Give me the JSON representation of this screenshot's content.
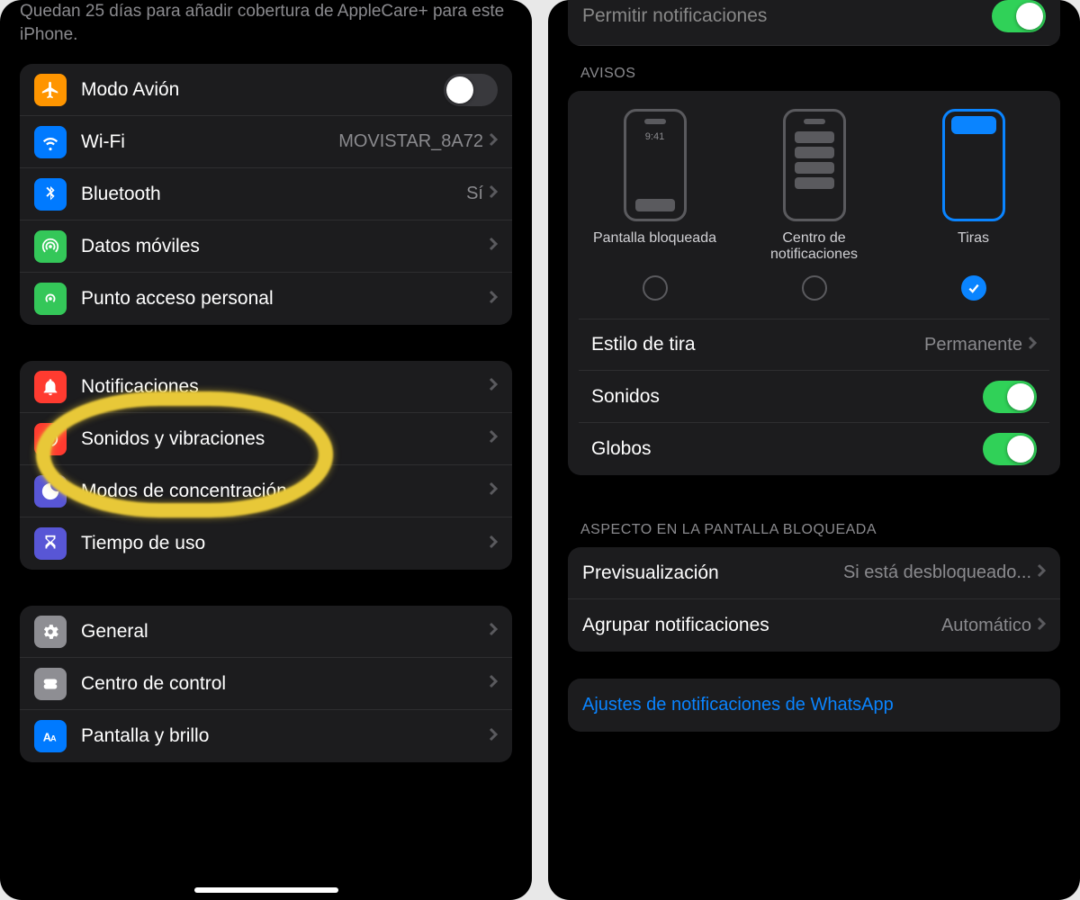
{
  "left": {
    "applecare_note": "Quedan 25 días para añadir cobertura de AppleCare+ para este iPhone.",
    "group1": {
      "airplane": "Modo Avión",
      "wifi": "Wi-Fi",
      "wifi_value": "MOVISTAR_8A72",
      "bluetooth": "Bluetooth",
      "bluetooth_value": "Sí",
      "cellular": "Datos móviles",
      "hotspot": "Punto acceso personal"
    },
    "group2": {
      "notifications": "Notificaciones",
      "sounds": "Sonidos y vibraciones",
      "focus": "Modos de concentración",
      "screentime": "Tiempo de uso"
    },
    "group3": {
      "general": "General",
      "control_center": "Centro de control",
      "display": "Pantalla y brillo"
    }
  },
  "right": {
    "allow_label": "Permitir notificaciones",
    "avisos_header": "AVISOS",
    "opt1": "Pantalla bloqueada",
    "opt1_time": "9:41",
    "opt2": "Centro de notificaciones",
    "opt3": "Tiras",
    "banner_style": "Estilo de tira",
    "banner_style_value": "Permanente",
    "sounds": "Sonidos",
    "badges": "Globos",
    "lockscreen_header": "ASPECTO EN LA PANTALLA BLOQUEADA",
    "preview": "Previsualización",
    "preview_value": "Si está desbloqueado...",
    "grouping": "Agrupar notificaciones",
    "grouping_value": "Automático",
    "whatsapp_link": "Ajustes de notificaciones de WhatsApp"
  },
  "colors": {
    "orange": "#ff9500",
    "blue": "#007aff",
    "green": "#34c759",
    "green2": "#30d158",
    "red": "#ff3b30",
    "purple": "#5856d6",
    "gray": "#8e8e93",
    "iosblue": "#0a84ff"
  }
}
